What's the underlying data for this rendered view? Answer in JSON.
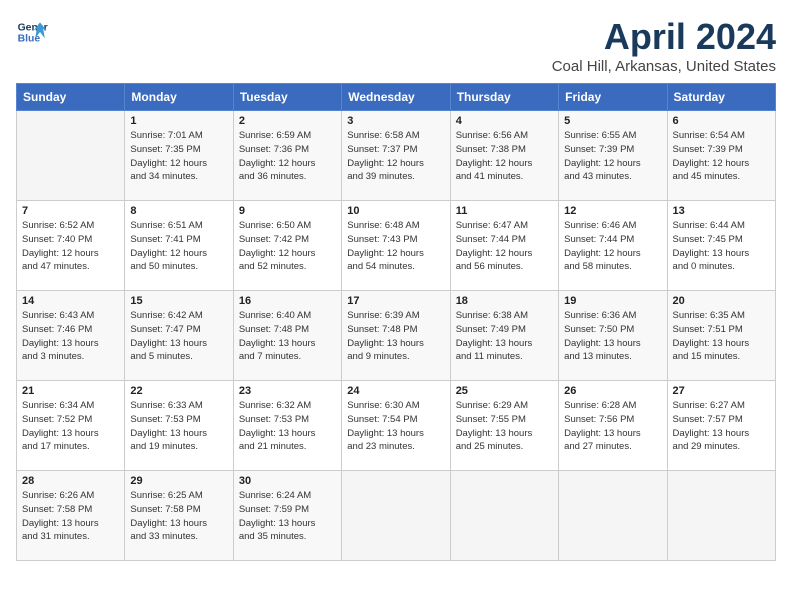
{
  "header": {
    "logo_line1": "General",
    "logo_line2": "Blue",
    "month": "April 2024",
    "location": "Coal Hill, Arkansas, United States"
  },
  "days_of_week": [
    "Sunday",
    "Monday",
    "Tuesday",
    "Wednesday",
    "Thursday",
    "Friday",
    "Saturday"
  ],
  "weeks": [
    [
      {
        "day": "",
        "info": ""
      },
      {
        "day": "1",
        "info": "Sunrise: 7:01 AM\nSunset: 7:35 PM\nDaylight: 12 hours\nand 34 minutes."
      },
      {
        "day": "2",
        "info": "Sunrise: 6:59 AM\nSunset: 7:36 PM\nDaylight: 12 hours\nand 36 minutes."
      },
      {
        "day": "3",
        "info": "Sunrise: 6:58 AM\nSunset: 7:37 PM\nDaylight: 12 hours\nand 39 minutes."
      },
      {
        "day": "4",
        "info": "Sunrise: 6:56 AM\nSunset: 7:38 PM\nDaylight: 12 hours\nand 41 minutes."
      },
      {
        "day": "5",
        "info": "Sunrise: 6:55 AM\nSunset: 7:39 PM\nDaylight: 12 hours\nand 43 minutes."
      },
      {
        "day": "6",
        "info": "Sunrise: 6:54 AM\nSunset: 7:39 PM\nDaylight: 12 hours\nand 45 minutes."
      }
    ],
    [
      {
        "day": "7",
        "info": "Sunrise: 6:52 AM\nSunset: 7:40 PM\nDaylight: 12 hours\nand 47 minutes."
      },
      {
        "day": "8",
        "info": "Sunrise: 6:51 AM\nSunset: 7:41 PM\nDaylight: 12 hours\nand 50 minutes."
      },
      {
        "day": "9",
        "info": "Sunrise: 6:50 AM\nSunset: 7:42 PM\nDaylight: 12 hours\nand 52 minutes."
      },
      {
        "day": "10",
        "info": "Sunrise: 6:48 AM\nSunset: 7:43 PM\nDaylight: 12 hours\nand 54 minutes."
      },
      {
        "day": "11",
        "info": "Sunrise: 6:47 AM\nSunset: 7:44 PM\nDaylight: 12 hours\nand 56 minutes."
      },
      {
        "day": "12",
        "info": "Sunrise: 6:46 AM\nSunset: 7:44 PM\nDaylight: 12 hours\nand 58 minutes."
      },
      {
        "day": "13",
        "info": "Sunrise: 6:44 AM\nSunset: 7:45 PM\nDaylight: 13 hours\nand 0 minutes."
      }
    ],
    [
      {
        "day": "14",
        "info": "Sunrise: 6:43 AM\nSunset: 7:46 PM\nDaylight: 13 hours\nand 3 minutes."
      },
      {
        "day": "15",
        "info": "Sunrise: 6:42 AM\nSunset: 7:47 PM\nDaylight: 13 hours\nand 5 minutes."
      },
      {
        "day": "16",
        "info": "Sunrise: 6:40 AM\nSunset: 7:48 PM\nDaylight: 13 hours\nand 7 minutes."
      },
      {
        "day": "17",
        "info": "Sunrise: 6:39 AM\nSunset: 7:48 PM\nDaylight: 13 hours\nand 9 minutes."
      },
      {
        "day": "18",
        "info": "Sunrise: 6:38 AM\nSunset: 7:49 PM\nDaylight: 13 hours\nand 11 minutes."
      },
      {
        "day": "19",
        "info": "Sunrise: 6:36 AM\nSunset: 7:50 PM\nDaylight: 13 hours\nand 13 minutes."
      },
      {
        "day": "20",
        "info": "Sunrise: 6:35 AM\nSunset: 7:51 PM\nDaylight: 13 hours\nand 15 minutes."
      }
    ],
    [
      {
        "day": "21",
        "info": "Sunrise: 6:34 AM\nSunset: 7:52 PM\nDaylight: 13 hours\nand 17 minutes."
      },
      {
        "day": "22",
        "info": "Sunrise: 6:33 AM\nSunset: 7:53 PM\nDaylight: 13 hours\nand 19 minutes."
      },
      {
        "day": "23",
        "info": "Sunrise: 6:32 AM\nSunset: 7:53 PM\nDaylight: 13 hours\nand 21 minutes."
      },
      {
        "day": "24",
        "info": "Sunrise: 6:30 AM\nSunset: 7:54 PM\nDaylight: 13 hours\nand 23 minutes."
      },
      {
        "day": "25",
        "info": "Sunrise: 6:29 AM\nSunset: 7:55 PM\nDaylight: 13 hours\nand 25 minutes."
      },
      {
        "day": "26",
        "info": "Sunrise: 6:28 AM\nSunset: 7:56 PM\nDaylight: 13 hours\nand 27 minutes."
      },
      {
        "day": "27",
        "info": "Sunrise: 6:27 AM\nSunset: 7:57 PM\nDaylight: 13 hours\nand 29 minutes."
      }
    ],
    [
      {
        "day": "28",
        "info": "Sunrise: 6:26 AM\nSunset: 7:58 PM\nDaylight: 13 hours\nand 31 minutes."
      },
      {
        "day": "29",
        "info": "Sunrise: 6:25 AM\nSunset: 7:58 PM\nDaylight: 13 hours\nand 33 minutes."
      },
      {
        "day": "30",
        "info": "Sunrise: 6:24 AM\nSunset: 7:59 PM\nDaylight: 13 hours\nand 35 minutes."
      },
      {
        "day": "",
        "info": ""
      },
      {
        "day": "",
        "info": ""
      },
      {
        "day": "",
        "info": ""
      },
      {
        "day": "",
        "info": ""
      }
    ]
  ]
}
